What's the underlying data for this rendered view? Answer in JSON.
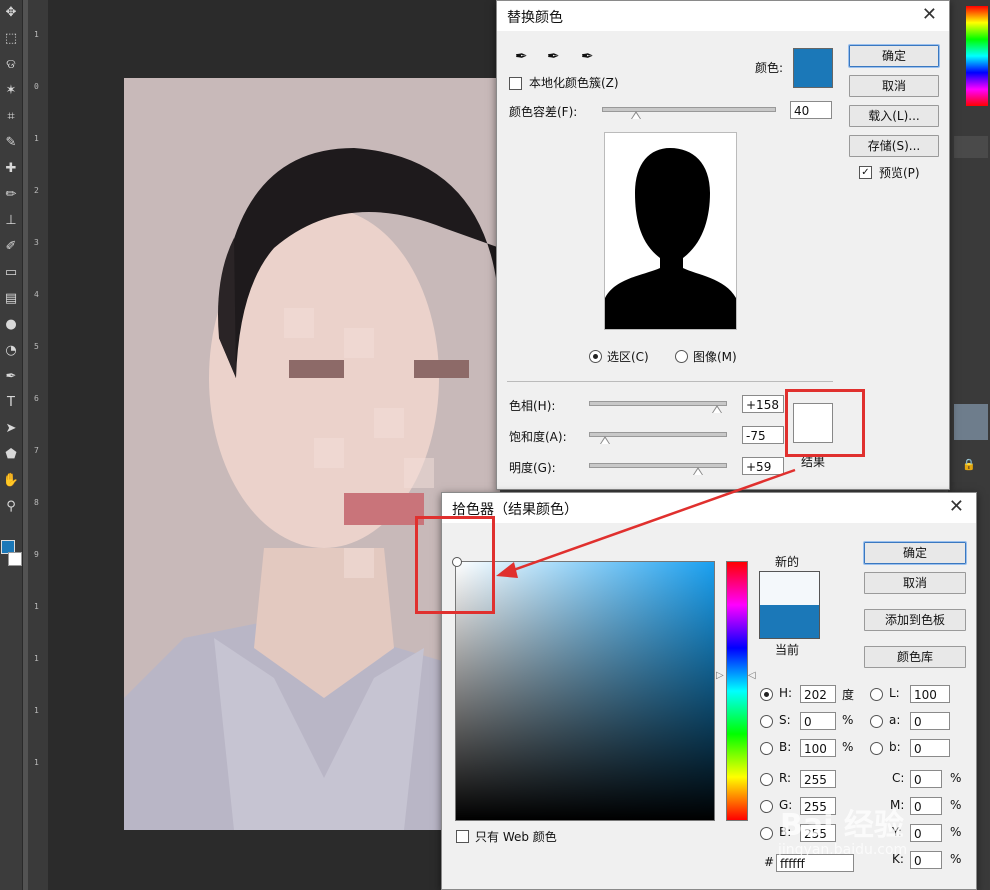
{
  "colors": {
    "swatch_blue": "#1b78b8",
    "highlight_red": "#e0302e"
  },
  "toolbar": {
    "icons": [
      "move-icon",
      "marquee-icon",
      "lasso-icon",
      "magic-wand-icon",
      "crop-icon",
      "eyedropper-icon",
      "healing-icon",
      "brush-icon",
      "stamp-icon",
      "history-brush-icon",
      "eraser-icon",
      "gradient-icon",
      "blur-icon",
      "dodge-icon",
      "pen-icon",
      "type-icon",
      "path-select-icon",
      "shape-icon",
      "hand-icon",
      "zoom-icon"
    ]
  },
  "ruler": {
    "marks": [
      "1",
      "0",
      "1",
      "2",
      "3",
      "4",
      "5",
      "6",
      "7",
      "8",
      "9",
      "1",
      "1",
      "1",
      "1"
    ]
  },
  "replace_color": {
    "title": "替换颜色",
    "localized_label": "本地化颜色簇(Z)",
    "color_label": "颜色:",
    "tolerance_label": "颜色容差(F):",
    "tolerance_value": "40",
    "tolerance_fraction": 0.2,
    "ok": "确定",
    "cancel": "取消",
    "load": "载入(L)...",
    "save": "存储(S)...",
    "preview": "预览(P)",
    "preview_checked": true,
    "radio_selection": "选区(C)",
    "radio_image": "图像(M)",
    "hue_label": "色相(H):",
    "hue_value": "+158",
    "hue_fraction": 0.94,
    "sat_label": "饱和度(A):",
    "sat_value": "-75",
    "sat_fraction": 0.12,
    "light_label": "明度(G):",
    "light_value": "+59",
    "light_fraction": 0.8,
    "result_label": "结果"
  },
  "color_picker": {
    "title": "拾色器（结果颜色）",
    "new_label": "新的",
    "current_label": "当前",
    "ok": "确定",
    "cancel": "取消",
    "add_swatch": "添加到色板",
    "color_libs": "颜色库",
    "web_only": "只有 Web 颜色",
    "H_label": "H:",
    "H": "202",
    "H_unit": "度",
    "S_label": "S:",
    "S": "0",
    "S_unit": "%",
    "B_label": "B:",
    "B": "100",
    "B_unit": "%",
    "R_label": "R:",
    "R": "255",
    "G_label": "G:",
    "G": "255",
    "Bl_label": "B:",
    "Bl": "255",
    "L_label": "L:",
    "L": "100",
    "a_label": "a:",
    "a": "0",
    "b_label": "b:",
    "b": "0",
    "C_label": "C:",
    "C": "0",
    "M_label": "M:",
    "M": "0",
    "Y_label": "Y:",
    "Y": "0",
    "K_label": "K:",
    "K": "0",
    "pct": "%",
    "hex_label": "#",
    "hex": "ffffff"
  },
  "watermark": {
    "text": "Bai 经验",
    "sub": "jingyan.baidu.com"
  }
}
